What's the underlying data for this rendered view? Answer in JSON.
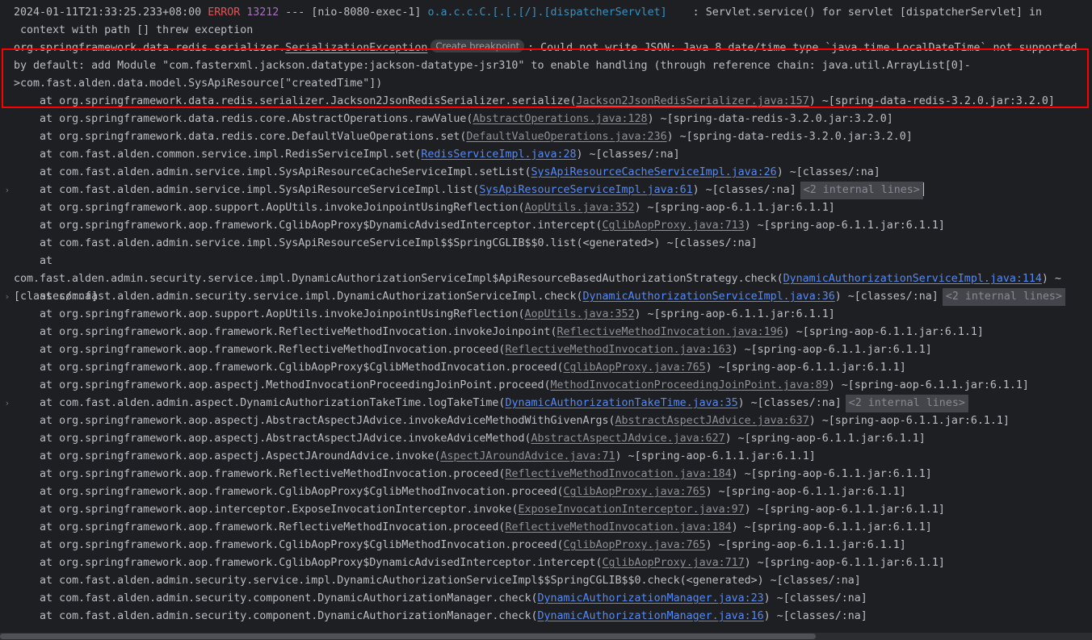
{
  "app": {
    "view": "intellij-run-console",
    "colors": {
      "background": "#1e1f22",
      "foreground": "#bcbec4",
      "error": "#e05555",
      "number": "#a771bf",
      "logger": "#3592c4",
      "link_external": "#8d9096",
      "link_project": "#548af7",
      "exception_border": "#ff0000",
      "fold_placeholder_bg": "#43454a",
      "hint_bg": "#3c3f41"
    }
  },
  "log_header": {
    "timestamp": "2024-01-11T21:33:25.233+08:00",
    "level": "ERROR",
    "pid": "13212",
    "separator": "---",
    "thread": "[nio-8080-exec-1]",
    "logger": "o.a.c.c.C.[.[.[/].[dispatcherServlet]",
    "colon": ":",
    "message_line1": "Servlet.service() for servlet [dispatcherServlet] in",
    "message_line2": "context with path [] threw exception"
  },
  "exception": {
    "class_prefix": "org.springframework.data.redis.serializer.",
    "class_name": "SerializationException",
    "hint_label": "Create breakpoint",
    "colon": ":",
    "message": "Could not write JSON: Java 8 date/time type `java.time.LocalDateTime` not supported by default: add Module \"com.fasterxml.jackson.datatype:jackson-datatype-jsr310\" to enable handling (through reference chain: java.util.ArrayList[0]->com.fast.alden.data.model.SysApiResource[\"createdTime\"])"
  },
  "fold_placeholder_label": "<2 internal lines>",
  "chevron_glyph": "›",
  "stack_frames": [
    {
      "at": "at",
      "frame": "org.springframework.data.redis.serializer.Jackson2JsonRedisSerializer.serialize(",
      "link": "Jackson2JsonRedisSerializer.java:157",
      "link_kind": "external",
      "suffix": ") ~[spring-data-redis-3.2.0.jar:3.2.0]",
      "folded": false,
      "chevron": false
    },
    {
      "at": "at",
      "frame": "org.springframework.data.redis.core.AbstractOperations.rawValue(",
      "link": "AbstractOperations.java:128",
      "link_kind": "external",
      "suffix": ") ~[spring-data-redis-3.2.0.jar:3.2.0]",
      "folded": false,
      "chevron": false
    },
    {
      "at": "at",
      "frame": "org.springframework.data.redis.core.DefaultValueOperations.set(",
      "link": "DefaultValueOperations.java:236",
      "link_kind": "external",
      "suffix": ") ~[spring-data-redis-3.2.0.jar:3.2.0]",
      "folded": false,
      "chevron": false
    },
    {
      "at": "at",
      "frame": "com.fast.alden.common.service.impl.RedisServiceImpl.set(",
      "link": "RedisServiceImpl.java:28",
      "link_kind": "project",
      "suffix": ") ~[classes/:na]",
      "folded": false,
      "chevron": false
    },
    {
      "at": "at",
      "frame": "com.fast.alden.admin.service.impl.SysApiResourceCacheServiceImpl.setList(",
      "link": "SysApiResourceCacheServiceImpl.java:26",
      "link_kind": "project",
      "suffix": ") ~[classes/:na]",
      "folded": false,
      "chevron": false
    },
    {
      "at": "at",
      "frame": "com.fast.alden.admin.service.impl.SysApiResourceServiceImpl.list(",
      "link": "SysApiResourceServiceImpl.java:61",
      "link_kind": "project",
      "suffix": ") ~[classes/:na]",
      "folded": true,
      "caret": true,
      "chevron": true
    },
    {
      "at": "at",
      "frame": "org.springframework.aop.support.AopUtils.invokeJoinpointUsingReflection(",
      "link": "AopUtils.java:352",
      "link_kind": "external",
      "suffix": ") ~[spring-aop-6.1.1.jar:6.1.1]",
      "folded": false,
      "chevron": false
    },
    {
      "at": "at",
      "frame": "org.springframework.aop.framework.CglibAopProxy$DynamicAdvisedInterceptor.intercept(",
      "link": "CglibAopProxy.java:713",
      "link_kind": "external",
      "suffix": ") ~[spring-aop-6.1.1.jar:6.1.1]",
      "folded": false,
      "chevron": false
    },
    {
      "at": "at",
      "frame": "com.fast.alden.admin.service.impl.SysApiResourceServiceImpl$$SpringCGLIB$$0.list(<generated>) ~[classes/:na]",
      "link": "",
      "link_kind": "none",
      "suffix": "",
      "folded": false,
      "chevron": false
    },
    {
      "at": "at",
      "frame": "com.fast.alden.admin.security.service.impl.DynamicAuthorizationServiceImpl$ApiResourceBasedAuthorizationStrategy.check(",
      "link": "DynamicAuthorizationServiceImpl.java:114",
      "link_kind": "project",
      "suffix": ") ~[classes/:na]",
      "folded": false,
      "chevron": false,
      "wrapped": 2
    },
    {
      "at": "at",
      "frame": "com.fast.alden.admin.security.service.impl.DynamicAuthorizationServiceImpl.check(",
      "link": "DynamicAuthorizationServiceImpl.java:36",
      "link_kind": "project",
      "suffix": ") ~[classes/:na]",
      "folded": true,
      "chevron": true
    },
    {
      "at": "at",
      "frame": "org.springframework.aop.support.AopUtils.invokeJoinpointUsingReflection(",
      "link": "AopUtils.java:352",
      "link_kind": "external",
      "suffix": ") ~[spring-aop-6.1.1.jar:6.1.1]",
      "folded": false,
      "chevron": false
    },
    {
      "at": "at",
      "frame": "org.springframework.aop.framework.ReflectiveMethodInvocation.invokeJoinpoint(",
      "link": "ReflectiveMethodInvocation.java:196",
      "link_kind": "external",
      "suffix": ") ~[spring-aop-6.1.1.jar:6.1.1]",
      "folded": false,
      "chevron": false
    },
    {
      "at": "at",
      "frame": "org.springframework.aop.framework.ReflectiveMethodInvocation.proceed(",
      "link": "ReflectiveMethodInvocation.java:163",
      "link_kind": "external",
      "suffix": ") ~[spring-aop-6.1.1.jar:6.1.1]",
      "folded": false,
      "chevron": false
    },
    {
      "at": "at",
      "frame": "org.springframework.aop.framework.CglibAopProxy$CglibMethodInvocation.proceed(",
      "link": "CglibAopProxy.java:765",
      "link_kind": "external",
      "suffix": ") ~[spring-aop-6.1.1.jar:6.1.1]",
      "folded": false,
      "chevron": false
    },
    {
      "at": "at",
      "frame": "org.springframework.aop.aspectj.MethodInvocationProceedingJoinPoint.proceed(",
      "link": "MethodInvocationProceedingJoinPoint.java:89",
      "link_kind": "external",
      "suffix": ") ~[spring-aop-6.1.1.jar:6.1.1]",
      "folded": false,
      "chevron": false
    },
    {
      "at": "at",
      "frame": "com.fast.alden.admin.aspect.DynamicAuthorizationTakeTime.logTakeTime(",
      "link": "DynamicAuthorizationTakeTime.java:35",
      "link_kind": "project",
      "suffix": ") ~[classes/:na]",
      "folded": true,
      "chevron": true
    },
    {
      "at": "at",
      "frame": "org.springframework.aop.aspectj.AbstractAspectJAdvice.invokeAdviceMethodWithGivenArgs(",
      "link": "AbstractAspectJAdvice.java:637",
      "link_kind": "external",
      "suffix": ") ~[spring-aop-6.1.1.jar:6.1.1]",
      "folded": false,
      "chevron": false
    },
    {
      "at": "at",
      "frame": "org.springframework.aop.aspectj.AbstractAspectJAdvice.invokeAdviceMethod(",
      "link": "AbstractAspectJAdvice.java:627",
      "link_kind": "external",
      "suffix": ") ~[spring-aop-6.1.1.jar:6.1.1]",
      "folded": false,
      "chevron": false
    },
    {
      "at": "at",
      "frame": "org.springframework.aop.aspectj.AspectJAroundAdvice.invoke(",
      "link": "AspectJAroundAdvice.java:71",
      "link_kind": "external",
      "suffix": ") ~[spring-aop-6.1.1.jar:6.1.1]",
      "folded": false,
      "chevron": false
    },
    {
      "at": "at",
      "frame": "org.springframework.aop.framework.ReflectiveMethodInvocation.proceed(",
      "link": "ReflectiveMethodInvocation.java:184",
      "link_kind": "external",
      "suffix": ") ~[spring-aop-6.1.1.jar:6.1.1]",
      "folded": false,
      "chevron": false
    },
    {
      "at": "at",
      "frame": "org.springframework.aop.framework.CglibAopProxy$CglibMethodInvocation.proceed(",
      "link": "CglibAopProxy.java:765",
      "link_kind": "external",
      "suffix": ") ~[spring-aop-6.1.1.jar:6.1.1]",
      "folded": false,
      "chevron": false
    },
    {
      "at": "at",
      "frame": "org.springframework.aop.interceptor.ExposeInvocationInterceptor.invoke(",
      "link": "ExposeInvocationInterceptor.java:97",
      "link_kind": "external",
      "suffix": ") ~[spring-aop-6.1.1.jar:6.1.1]",
      "folded": false,
      "chevron": false
    },
    {
      "at": "at",
      "frame": "org.springframework.aop.framework.ReflectiveMethodInvocation.proceed(",
      "link": "ReflectiveMethodInvocation.java:184",
      "link_kind": "external",
      "suffix": ") ~[spring-aop-6.1.1.jar:6.1.1]",
      "folded": false,
      "chevron": false
    },
    {
      "at": "at",
      "frame": "org.springframework.aop.framework.CglibAopProxy$CglibMethodInvocation.proceed(",
      "link": "CglibAopProxy.java:765",
      "link_kind": "external",
      "suffix": ") ~[spring-aop-6.1.1.jar:6.1.1]",
      "folded": false,
      "chevron": false
    },
    {
      "at": "at",
      "frame": "org.springframework.aop.framework.CglibAopProxy$DynamicAdvisedInterceptor.intercept(",
      "link": "CglibAopProxy.java:717",
      "link_kind": "external",
      "suffix": ") ~[spring-aop-6.1.1.jar:6.1.1]",
      "folded": false,
      "chevron": false
    },
    {
      "at": "at",
      "frame": "com.fast.alden.admin.security.service.impl.DynamicAuthorizationServiceImpl$$SpringCGLIB$$0.check(<generated>) ~[classes/:na]",
      "link": "",
      "link_kind": "none",
      "suffix": "",
      "folded": false,
      "chevron": false
    },
    {
      "at": "at",
      "frame": "com.fast.alden.admin.security.component.DynamicAuthorizationManager.check(",
      "link": "DynamicAuthorizationManager.java:23",
      "link_kind": "project",
      "suffix": ") ~[classes/:na]",
      "folded": false,
      "chevron": false
    },
    {
      "at": "at",
      "frame": "com.fast.alden.admin.security.component.DynamicAuthorizationManager.check(",
      "link": "DynamicAuthorizationManager.java:16",
      "link_kind": "project",
      "suffix": ") ~[classes/:na]",
      "folded": false,
      "chevron": false
    }
  ],
  "scrollbar": {
    "orientation": "horizontal",
    "thumb_ratio": 0.75
  }
}
